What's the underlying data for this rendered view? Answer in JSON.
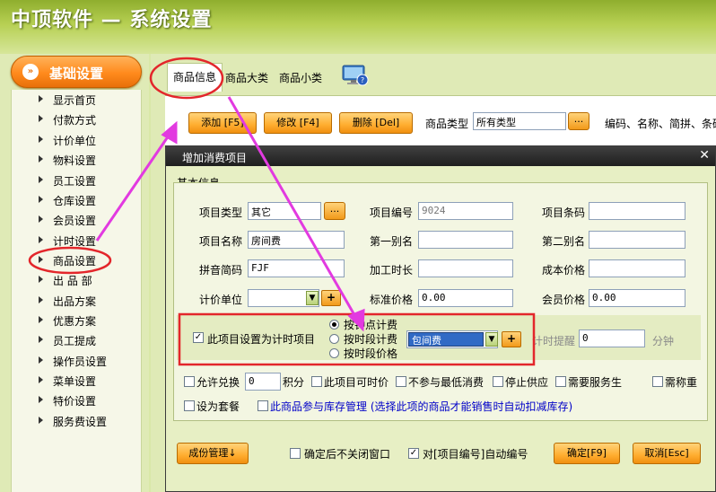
{
  "banner": {
    "title": "中顶软件 — 系统设置"
  },
  "sidebar": {
    "header": "基础设置",
    "items": [
      {
        "label": "显示首页"
      },
      {
        "label": "付款方式"
      },
      {
        "label": "计价单位"
      },
      {
        "label": "物料设置"
      },
      {
        "label": "员工设置"
      },
      {
        "label": "仓库设置"
      },
      {
        "label": "会员设置"
      },
      {
        "label": "计时设置"
      },
      {
        "label": "商品设置"
      },
      {
        "label": "出 品 部"
      },
      {
        "label": "出品方案"
      },
      {
        "label": "优惠方案"
      },
      {
        "label": "员工提成"
      },
      {
        "label": "操作员设置"
      },
      {
        "label": "菜单设置"
      },
      {
        "label": "特价设置"
      },
      {
        "label": "服务费设置"
      }
    ]
  },
  "tabs": [
    {
      "label": "商品信息"
    },
    {
      "label": "商品大类"
    },
    {
      "label": "商品小类"
    }
  ],
  "toolbar": {
    "add": "添加 [F5]",
    "edit": "修改 [F4]",
    "delete": "删除 [Del]",
    "type_label": "商品类型",
    "type_value": "所有类型",
    "dots": "...",
    "search_hint": "编码、名称、简拼、条码"
  },
  "dialog": {
    "title": "增加消费项目",
    "group_title": "基本信息",
    "fields": {
      "item_type_label": "项目类型",
      "item_type_value": "其它",
      "item_code_label": "项目编号",
      "item_code_value": "9024",
      "barcode_label": "项目条码",
      "barcode_value": "",
      "item_name_label": "项目名称",
      "item_name_value": "房间费",
      "alias1_label": "第一别名",
      "alias1_value": "",
      "alias2_label": "第二别名",
      "alias2_value": "",
      "pinyin_label": "拼音简码",
      "pinyin_value": "FJF",
      "process_label": "加工时长",
      "process_value": "",
      "cost_label": "成本价格",
      "cost_value": "",
      "unit_label": "计价单位",
      "unit_value": "",
      "std_price_label": "标准价格",
      "std_price_value": "0.00",
      "member_price_label": "会员价格",
      "member_price_value": "0.00"
    },
    "timer": {
      "checkbox_label": "此项目设置为计时项目",
      "checked": true,
      "options": [
        "按钟点计费",
        "按时段计费",
        "按时段价格"
      ],
      "selected_option": "按钟点计费",
      "plan_value": "包间费",
      "remind_label": "计时提醒",
      "remind_value": "0",
      "remind_unit": "分钟"
    },
    "options_row1": [
      {
        "label": "允许兑换",
        "checked": false
      },
      {
        "label": "积分",
        "value": "0"
      },
      {
        "label": "此项目可时价",
        "checked": false
      },
      {
        "label": "不参与最低消费",
        "checked": false
      },
      {
        "label": "停止供应",
        "checked": false
      },
      {
        "label": "需要服务生",
        "checked": false
      },
      {
        "label": "需称重",
        "checked": false
      }
    ],
    "options_row2": [
      {
        "label": "设为套餐",
        "checked": false
      },
      {
        "label": "此商品参与库存管理 (选择此项的商品才能销售时自动扣减库存)",
        "checked": false
      }
    ],
    "footer": {
      "portion_button": "成份管理↓",
      "keep_open_label": "确定后不关闭窗口",
      "keep_open_checked": false,
      "auto_number_label": "对[项目编号]自动编号",
      "auto_number_checked": true,
      "confirm": "确定[F9]",
      "cancel": "取消[Esc]"
    }
  },
  "colors": {
    "annotation_arrow": "#e23ae0",
    "annotation_circle": "#e3262b",
    "accent_orange": "#ff9a2a"
  }
}
